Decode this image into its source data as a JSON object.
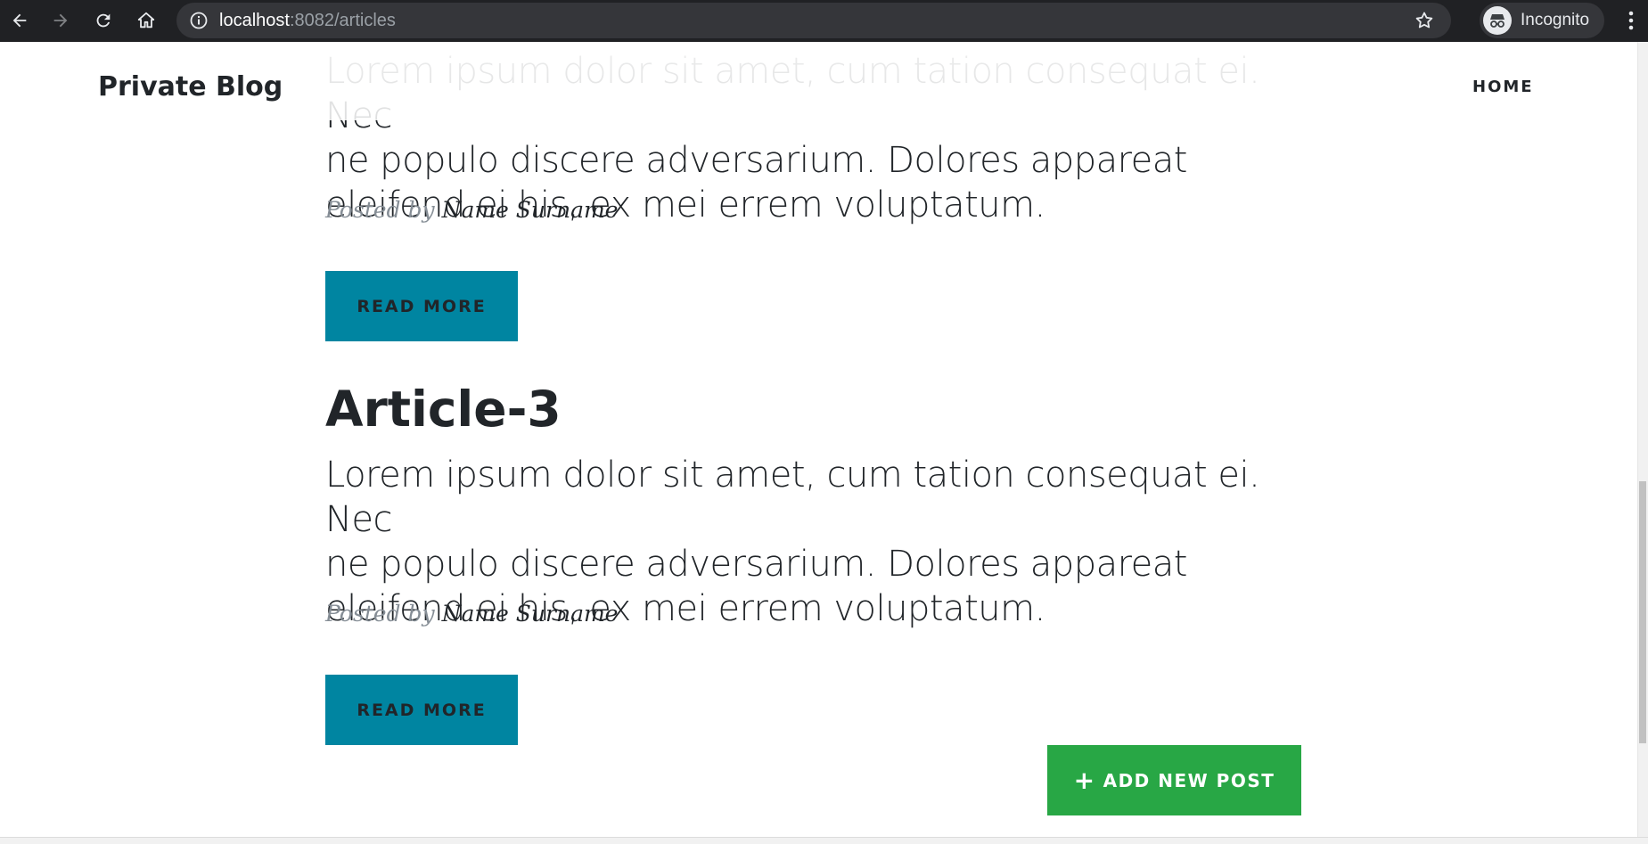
{
  "browser": {
    "url_host": "localhost",
    "url_rest": ":8082/articles",
    "profile_label": "Incognito"
  },
  "site": {
    "brand": "Private Blog",
    "nav_home": "HOME"
  },
  "articles": [
    {
      "excerpt_lines": [
        "Lorem ipsum dolor sit amet, cum tation consequat ei. Nec",
        "ne populo discere adversarium. Dolores appareat",
        "eleifend ei his, ex mei errem voluptatum."
      ],
      "posted_by": "Posted by",
      "author": "Name Surname",
      "read_more": "READ MORE"
    },
    {
      "title": "Article-3",
      "excerpt_lines": [
        "Lorem ipsum dolor sit amet, cum tation consequat ei. Nec",
        "ne populo discere adversarium. Dolores appareat",
        "eleifend ei his, ex mei errem voluptatum."
      ],
      "posted_by": "Posted by",
      "author": "Name Surname",
      "read_more": "READ MORE"
    }
  ],
  "add_post_button": {
    "icon": "+",
    "label": "ADD NEW POST"
  },
  "colors": {
    "primary_button": "#0085a1",
    "success_button": "#28a745",
    "text": "#212529",
    "muted": "#868e96"
  }
}
